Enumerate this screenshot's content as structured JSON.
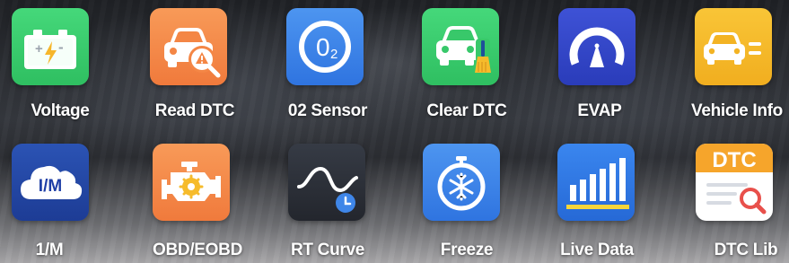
{
  "colors": {
    "green": "#3ccf6e",
    "orange": "#f4894a",
    "blue": "#3f86e8",
    "yellow": "#f6bb2b",
    "navy": "#1f3fa6",
    "dark": "#2c3039"
  },
  "apps": [
    {
      "label": "Voltage",
      "icon": "battery-icon"
    },
    {
      "label": "Read DTC",
      "icon": "car-search-icon"
    },
    {
      "label": "02 Sensor",
      "icon": "o2-sensor-icon"
    },
    {
      "label": "Clear DTC",
      "icon": "car-broom-icon"
    },
    {
      "label": "EVAP",
      "icon": "evap-gauge-icon"
    },
    {
      "label": "Vehicle Info",
      "icon": "vehicle-info-icon"
    },
    {
      "label": "1/M",
      "icon": "im-cloud-icon"
    },
    {
      "label": "OBD/EOBD",
      "icon": "engine-icon"
    },
    {
      "label": "RT Curve",
      "icon": "rt-curve-icon"
    },
    {
      "label": "Freeze",
      "icon": "freeze-timer-icon"
    },
    {
      "label": "Live Data",
      "icon": "bar-chart-icon"
    },
    {
      "label": "DTC Lib",
      "icon": "dtc-library-icon"
    }
  ],
  "icon_text": {
    "o2": "0",
    "o2_sub": "2",
    "im": "I/M",
    "dtc": "DTC"
  }
}
